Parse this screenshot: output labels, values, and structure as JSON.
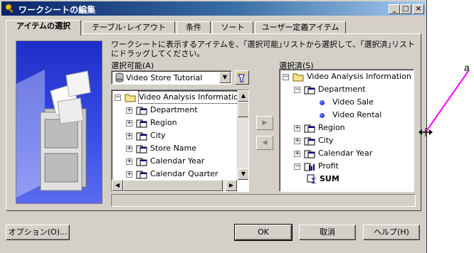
{
  "window": {
    "title": "ワークシートの編集",
    "buttons": {
      "minimize": "_",
      "maximize": "□",
      "close": "×"
    }
  },
  "tabs": [
    {
      "label": "アイテムの選択",
      "active": true
    },
    {
      "label": "テーブル･レイアウト",
      "active": false
    },
    {
      "label": "条件",
      "active": false
    },
    {
      "label": "ソート",
      "active": false
    },
    {
      "label": "ユーザー定義アイテム",
      "active": false
    }
  ],
  "instruction": "ワークシートに表示するアイテムを、｢選択可能｣リストから選択して、｢選択済｣リストにドラッグしてください。",
  "available": {
    "label": "選択可能(A)",
    "business_area": "Video Store Tutorial",
    "root": "Video Analysis Information",
    "items": [
      "Department",
      "Region",
      "City",
      "Store Name",
      "Calendar Year",
      "Calendar Quarter"
    ]
  },
  "selected": {
    "label": "選択済(S)",
    "root": "Video Analysis Information",
    "department": "Department",
    "department_children": [
      "Video Sale",
      "Video Rental"
    ],
    "items": [
      "Region",
      "City",
      "Calendar Year"
    ],
    "profit": "Profit",
    "profit_children": [
      "SUM"
    ]
  },
  "move_buttons": {
    "add": "▶",
    "remove": "◀"
  },
  "scroll_glyphs": {
    "up": "▲",
    "down": "▼",
    "left": "◀",
    "right": "▶",
    "dropdown": "▼"
  },
  "buttons": {
    "options": "オプション(O)...",
    "ok": "OK",
    "cancel": "取消",
    "help": "ヘルプ(H)"
  },
  "annotation": {
    "label": "a"
  },
  "colors": {
    "title_start": "#0a246a",
    "title_end": "#a6caf0",
    "face": "#d4d0c8",
    "annotation_line": "#ff00ff"
  }
}
